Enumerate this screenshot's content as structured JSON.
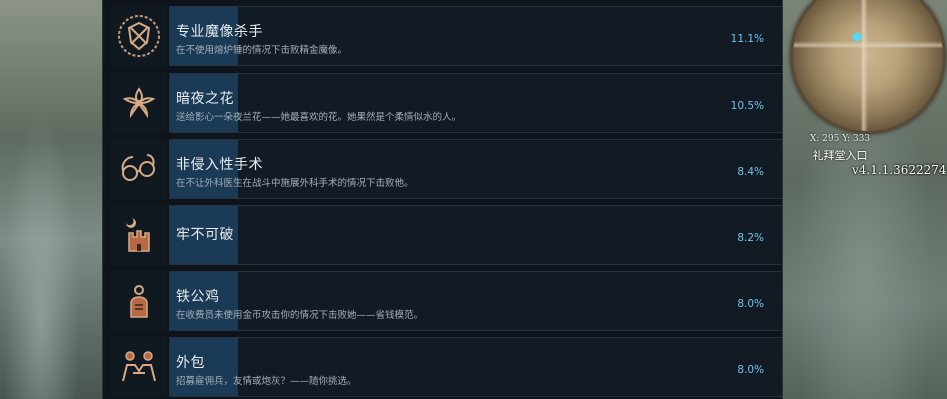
{
  "achievements": [
    {
      "title": "专业魔像杀手",
      "description": "在不使用熔炉锤的情况下击败精金魔像。",
      "percent": "11.1%",
      "icon": "swords-shield-icon"
    },
    {
      "title": "暗夜之花",
      "description": "送给影心一朵夜兰花——她最喜欢的花。她果然是个柔情似水的人。",
      "percent": "10.5%",
      "icon": "flower-icon"
    },
    {
      "title": "非侵入性手术",
      "description": "在不让外科医生在战斗中施展外科手术的情况下击败他。",
      "percent": "8.4%",
      "icon": "spectacles-icon"
    },
    {
      "title": "牢不可破",
      "description": "",
      "percent": "8.2%",
      "icon": "castle-moon-icon"
    },
    {
      "title": "铁公鸡",
      "description": "在收费员未使用金币攻击你的情况下击败她——省钱模范。",
      "percent": "8.0%",
      "icon": "coin-hand-icon"
    },
    {
      "title": "外包",
      "description": "招募雇佣兵，友情或炮灰？——随你挑选。",
      "percent": "8.0%",
      "icon": "handshake-icon"
    }
  ],
  "hud": {
    "coords": "X: 295 Y: 333",
    "location": "礼拜堂入口",
    "version": "v4.1.1.3622274"
  }
}
